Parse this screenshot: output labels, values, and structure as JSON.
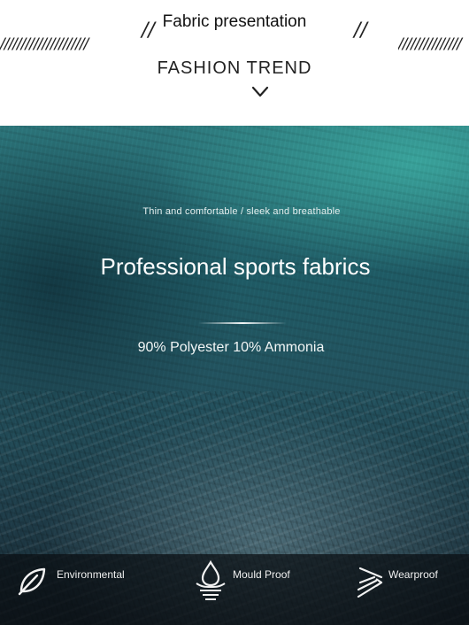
{
  "header": {
    "title": "Fabric presentation",
    "subtitle": "FASHION TREND",
    "slashes_left": "/////////////////////",
    "slashes_right": "///////////////",
    "double_slash": "//",
    "chevron_icon": "chevron-down-icon"
  },
  "hero": {
    "tagline": "Thin and comfortable / sleek and breathable",
    "heading": "Professional sports fabrics",
    "composition": "90% Polyester 10% Ammonia"
  },
  "features": [
    {
      "label": "Environmental",
      "icon": "leaf-icon"
    },
    {
      "label": "Mould Proof",
      "icon": "droplet-icon"
    },
    {
      "label": "Wearproof",
      "icon": "wear-arrows-icon"
    }
  ]
}
